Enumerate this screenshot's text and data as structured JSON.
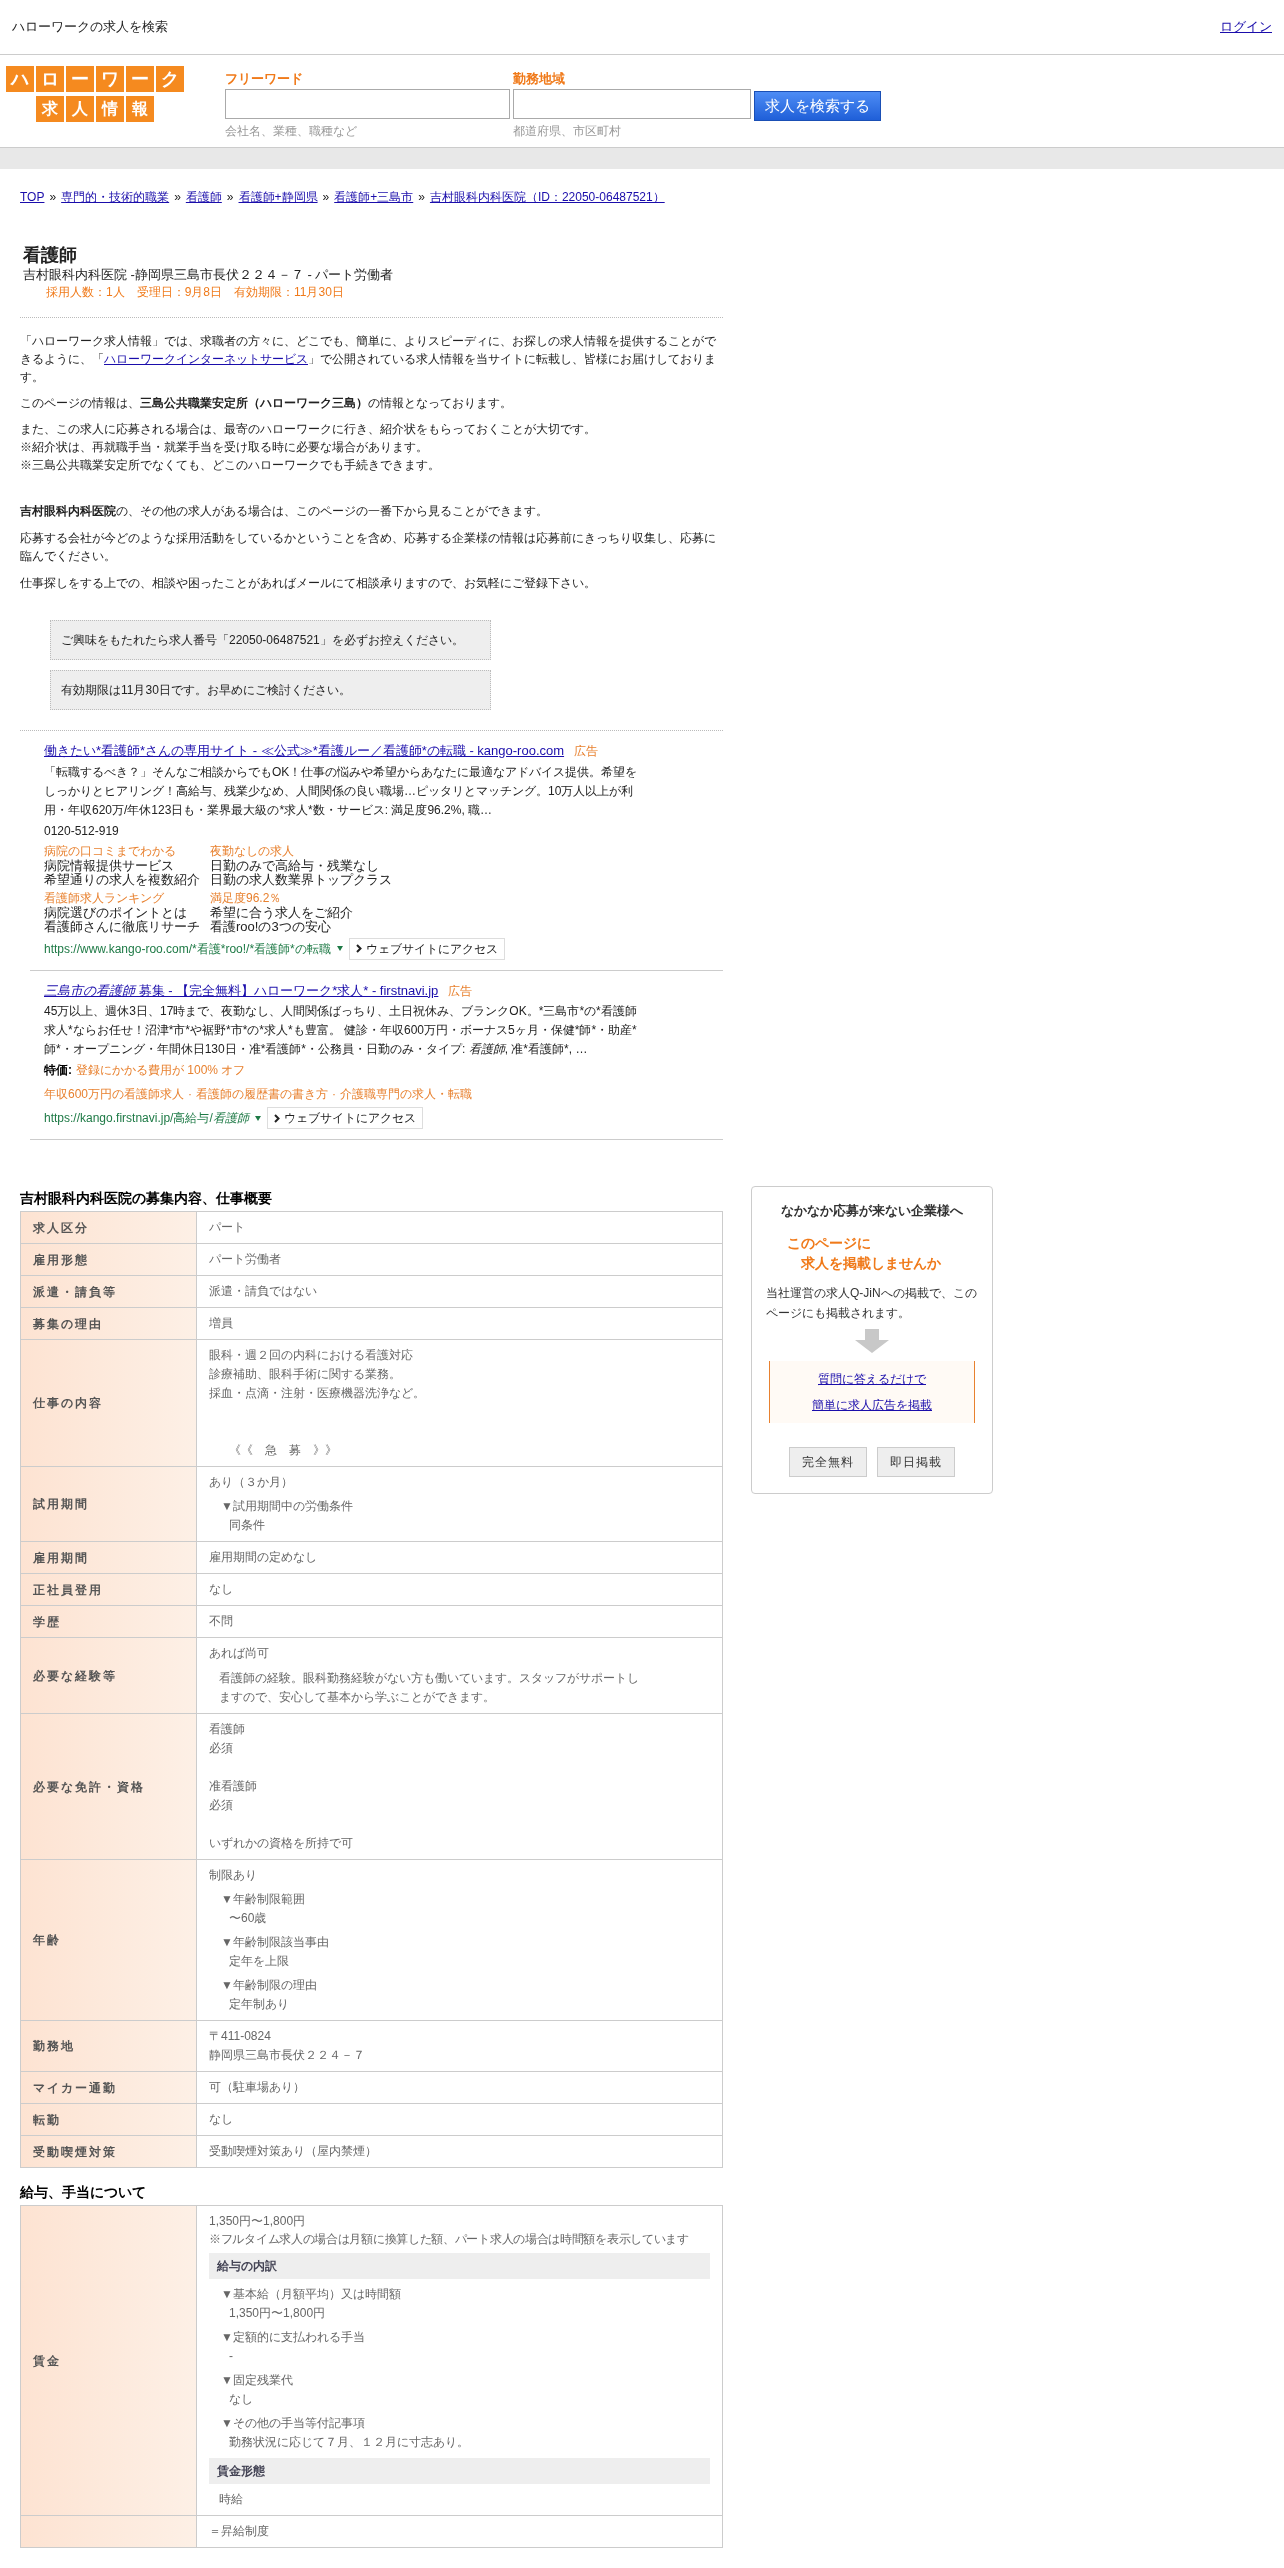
{
  "header": {
    "site_title": "ハローワークの求人を検索",
    "login_link": "ログイン"
  },
  "logo": {
    "top": [
      "ハ",
      "ロ",
      "ー",
      "ワ",
      "ー",
      "ク"
    ],
    "bottom": [
      "求",
      "人",
      "情",
      "報"
    ]
  },
  "search": {
    "fields": [
      {
        "label": "フリーワード",
        "hint": "会社名、業種、職種など"
      },
      {
        "label": "勤務地域",
        "hint": "都道府県、市区町村"
      }
    ],
    "button": "求人を検索する"
  },
  "breadcrumb_separator": "»",
  "breadcrumb": [
    "TOP",
    "専門的・技術的職業",
    "看護師",
    "看護師+静岡県",
    "看護師+三島市",
    "吉村眼科内科医院（ID：22050-06487521）"
  ],
  "job": {
    "title": "看護師",
    "subtitle": "吉村眼科内科医院 -静岡県三島市長伏２２４－７ - パート労働者",
    "meta": "採用人数：1人　受理日：9月8日　有効期限：11月30日"
  },
  "intro": [
    {
      "before": "「ハローワーク求人情報」では、求職者の方々に、どこでも、簡単に、よりスピーディに、お探しの求人情報を提供することができるように、「",
      "link": "ハローワークインターネットサービス",
      "after": "」で公開されている求人情報を当サイトに転載し、皆様にお届けしております。"
    },
    {
      "lines": [
        "このページの情報は、**三島公共職業安定所（ハローワーク三島）**の情報となっております。"
      ]
    },
    {
      "lines": [
        "また、この求人に応募される場合は、最寄のハローワークに行き、紹介状をもらっておくことが大切です。",
        "※紹介状は、再就職手当・就業手当を受け取る時に必要な場合があります。",
        "※三島公共職業安定所でなくても、どこのハローワークでも手続きできます。"
      ]
    }
  ],
  "intro2": [
    "**吉村眼科内科医院**の、その他の求人がある場合は、このページの一番下から見ることができます。",
    "応募する会社が今どのような採用活動をしているかということを含め、応募する企業様の情報は応募前にきっちり収集し、応募に臨んでください。",
    "仕事探しをする上での、相談や困ったことがあればメールにて相談承りますので、お気軽にご登録下さい。"
  ],
  "notices": [
    "ご興味をもたれたら求人番号「22050-06487521」を必ずお控えください。",
    "有効期限は11月30日です。お早めにご検討ください。"
  ],
  "ads": [
    {
      "title": "働きたい*看護師*さんの専用サイト - ≪公式≫*看護ルー／看護師*の転職 - kango-roo.com",
      "label": "広告",
      "description": "「転職するべき？」そんなご相談からでもOK！仕事の悩みや希望からあなたに最適なアドバイス提供。希望をしっかりとヒアリング！高給与、残業少なめ、人間関係の良い職場…ピッタリとマッチング。10万人以上が利用・年収620万/年休123日も・業界最大級の*求人*数・サービス: 満足度96.2%, 職…",
      "phone": "0120-512-919",
      "sitelinks": [
        {
          "title": "病院の口コミまでわかる",
          "lines": [
            "病院情報提供サービス",
            "希望通りの求人を複数紹介"
          ]
        },
        {
          "title": "夜勤なしの求人",
          "lines": [
            "日勤のみで高給与・残業なし",
            "日勤の求人数業界トップクラス"
          ]
        },
        {
          "title": "看護師求人ランキング",
          "lines": [
            "病院選びのポイントとは",
            "看護師さんに徹底リサーチ"
          ]
        },
        {
          "title": "満足度96.2％",
          "lines": [
            "希望に合う求人をご紹介",
            "看護roo!の3つの安心"
          ]
        }
      ],
      "url": "https://www.kango-roo.com/*看護*roo!/*看護師*の転職",
      "visit": "ウェブサイトにアクセス"
    },
    {
      "title": "*三島市の看護師* 募集 - 【完全無料】ハローワーク*求人* - firstnavi.jp",
      "label": "広告",
      "description": "45万以上、週休3日、17時まで、夜勤なし、人間関係ばっちり、土日祝休み、ブランクOK。*三島市*の*看護師求人*ならお任せ！沼津*市*や裾野*市*の*求人*も豊富。 健診・年収600万円・ボーナス5ヶ月・保健*師*・助産*師*・オープニング・年間休日130日・准*看護師*・公務員・日勤のみ・タイプ: *看護師*, 准*看護師*, …",
      "special": {
        "label": "特価:",
        "text": "登録にかかる費用が 100% オフ"
      },
      "link_separator": "·",
      "links": [
        "年収600万円の看護師求人",
        "看護師の履歴書の書き方",
        "介護職専門の求人・転職"
      ],
      "url": "https://kango.firstnavi.jp/高給与/*看護師*",
      "visit": "ウェブサイトにアクセス"
    }
  ],
  "sections": [
    {
      "title": "吉村眼科内科医院の募集内容、仕事概要",
      "rows": [
        {
          "label": "求人区分",
          "lines": [
            {
              "kind": "text",
              "text": "パート"
            }
          ]
        },
        {
          "label": "雇用形態",
          "lines": [
            {
              "kind": "text",
              "text": "パート労働者"
            }
          ]
        },
        {
          "label": "派遣・請負等",
          "lines": [
            {
              "kind": "text",
              "text": "派遣・請負ではない"
            }
          ]
        },
        {
          "label": "募集の理由",
          "lines": [
            {
              "kind": "text",
              "text": "増員"
            }
          ]
        },
        {
          "label": "仕事の内容",
          "lines": [
            {
              "kind": "text",
              "text": "眼科・週２回の内科における看護対応"
            },
            {
              "kind": "text",
              "text": "診療補助、眼科手術に関する業務。"
            },
            {
              "kind": "text",
              "text": "採血・点滴・注射・医療機器洗浄など。"
            },
            {
              "kind": "blank"
            },
            {
              "kind": "blank"
            },
            {
              "kind": "urgent",
              "text": "《《　急　募　》》"
            }
          ]
        },
        {
          "label": "試用期間",
          "lines": [
            {
              "kind": "text",
              "text": "あり（３か月）"
            },
            {
              "kind": "head",
              "text": "▼試用期間中の労働条件"
            },
            {
              "kind": "sub",
              "text": "同条件"
            }
          ]
        },
        {
          "label": "雇用期間",
          "lines": [
            {
              "kind": "text",
              "text": "雇用期間の定めなし"
            }
          ]
        },
        {
          "label": "正社員登用",
          "lines": [
            {
              "kind": "text",
              "text": "なし"
            }
          ]
        },
        {
          "label": "学歴",
          "lines": [
            {
              "kind": "text",
              "text": "不問"
            }
          ]
        },
        {
          "label": "必要な経験等",
          "lines": [
            {
              "kind": "text",
              "text": "あれば尚可"
            },
            {
              "kind": "indented",
              "text": "看護師の経験。眼科勤務経験がない方も働いています。スタッフがサポートしますので、安心して基本から学ぶことができます。"
            }
          ]
        },
        {
          "label": "必要な免許・資格",
          "lines": [
            {
              "kind": "text",
              "text": "看護師"
            },
            {
              "kind": "text",
              "text": "必須"
            },
            {
              "kind": "blank"
            },
            {
              "kind": "text",
              "text": "准看護師"
            },
            {
              "kind": "text",
              "text": "必須"
            },
            {
              "kind": "blank"
            },
            {
              "kind": "text",
              "text": "いずれかの資格を所持で可"
            }
          ]
        },
        {
          "label": "年齢",
          "lines": [
            {
              "kind": "text",
              "text": "制限あり"
            },
            {
              "kind": "head",
              "text": "▼年齢制限範囲"
            },
            {
              "kind": "sub",
              "text": "〜60歳"
            },
            {
              "kind": "head",
              "text": "▼年齢制限該当事由"
            },
            {
              "kind": "sub",
              "text": "定年を上限"
            },
            {
              "kind": "head",
              "text": "▼年齢制限の理由"
            },
            {
              "kind": "sub",
              "text": "定年制あり"
            }
          ]
        },
        {
          "label": "勤務地",
          "lines": [
            {
              "kind": "text",
              "text": "〒411-0824"
            },
            {
              "kind": "text",
              "text": "静岡県三島市長伏２２４－７"
            }
          ]
        },
        {
          "label": "マイカー通勤",
          "lines": [
            {
              "kind": "text",
              "text": "可（駐車場あり）"
            }
          ]
        },
        {
          "label": "転勤",
          "lines": [
            {
              "kind": "text",
              "text": "なし"
            }
          ]
        },
        {
          "label": "受動喫煙対策",
          "lines": [
            {
              "kind": "text",
              "text": "受動喫煙対策あり（屋内禁煙）"
            }
          ]
        }
      ]
    },
    {
      "title": "給与、手当について",
      "rows": [
        {
          "label": "賃金",
          "lines": [
            {
              "kind": "text",
              "text": "1,350円〜1,800円"
            },
            {
              "kind": "note",
              "text": "※フルタイム求人の場合は月額に換算した額、パート求人の場合は時間額を表示しています"
            },
            {
              "kind": "band",
              "text": "給与の内訳"
            },
            {
              "kind": "head",
              "text": "▼基本給（月額平均）又は時間額"
            },
            {
              "kind": "sub",
              "text": "1,350円〜1,800円"
            },
            {
              "kind": "head",
              "text": "▼定額的に支払われる手当"
            },
            {
              "kind": "sub",
              "text": "-"
            },
            {
              "kind": "head",
              "text": "▼固定残業代"
            },
            {
              "kind": "sub",
              "text": "なし"
            },
            {
              "kind": "head",
              "text": "▼その他の手当等付記事項"
            },
            {
              "kind": "sub",
              "text": "勤務状況に応じて７月、１２月に寸志あり。"
            },
            {
              "kind": "band",
              "text": "賃金形態"
            },
            {
              "kind": "indented",
              "text": "時給"
            }
          ]
        },
        {
          "lines": [
            {
              "kind": "text",
              "text": "＝昇給制度"
            }
          ]
        }
      ]
    }
  ],
  "sidebar": {
    "heading": "なかなか応募が来ない企業様へ",
    "highlight": [
      "このページに",
      "求人を掲載しませんか"
    ],
    "text": "当社運営の求人Q-JiNへの掲載で、このページにも掲載されます。",
    "links": [
      "質問に答えるだけで",
      "簡単に求人広告を掲載"
    ],
    "badges": [
      "完全無料",
      "即日掲載"
    ]
  }
}
